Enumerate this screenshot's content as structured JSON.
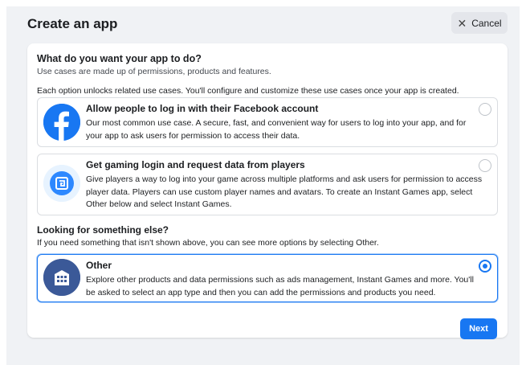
{
  "dialog": {
    "title": "Create an app",
    "cancel_label": "Cancel"
  },
  "question": {
    "heading": "What do you want your app to do?",
    "subheading": "Use cases are made up of permissions, products and features.",
    "note": "Each option unlocks related use cases. You'll configure and customize these use cases once your app is created."
  },
  "options": [
    {
      "title": "Allow people to log in with their Facebook account",
      "description": "Our most common use case. A secure, fast, and convenient way for users to log into your app, and for your app to ask users for permission to access their data.",
      "icon": "facebook-logo-icon",
      "selected": false
    },
    {
      "title": "Get gaming login and request data from players",
      "description": "Give players a way to log into your game across multiple platforms and ask users for permission to access player data. Players can use custom player names and avatars. To create an Instant Games app, select Other below and select Instant Games.",
      "icon": "gaming-controller-icon",
      "selected": false
    },
    {
      "title": "Other",
      "description": "Explore other products and data permissions such as ads management, Instant Games and more. You'll be asked to select an app type and then you can add the permissions and products you need.",
      "icon": "building-icon",
      "selected": true
    }
  ],
  "something_else": {
    "heading": "Looking for something else?",
    "subheading": "If you need something that isn't shown above, you can see more options by selecting Other."
  },
  "footer": {
    "next_label": "Next"
  },
  "colors": {
    "accent": "#1877f2",
    "facebook_blue": "#1877f2",
    "gaming_blue": "#2d88ff",
    "other_navy": "#3b5998",
    "background": "#f0f2f5"
  }
}
